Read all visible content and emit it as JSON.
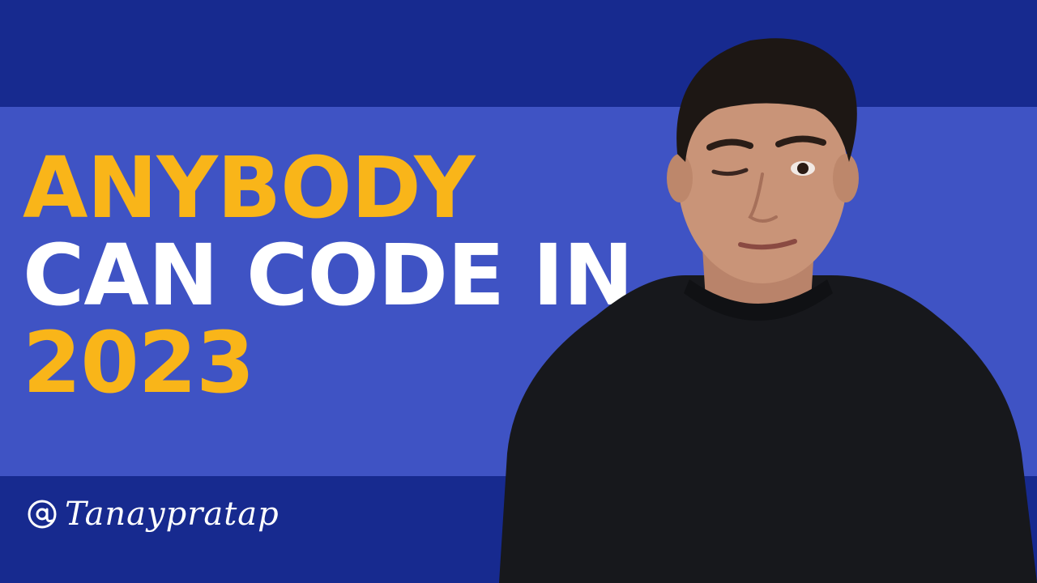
{
  "thumbnail": {
    "headline": {
      "line1": "ANYBODY",
      "line2": "CAN CODE IN",
      "line3": "2023"
    },
    "handle": {
      "icon": "at-sign-icon",
      "text": "Tanaypratap"
    },
    "colors": {
      "band_dark": "#172a8f",
      "band_mid": "#3f53c4",
      "accent_yellow": "#f9b519",
      "text_white": "#ffffff",
      "sweater": "#17181c",
      "hair": "#1d1714",
      "skin": "#c99478"
    }
  }
}
